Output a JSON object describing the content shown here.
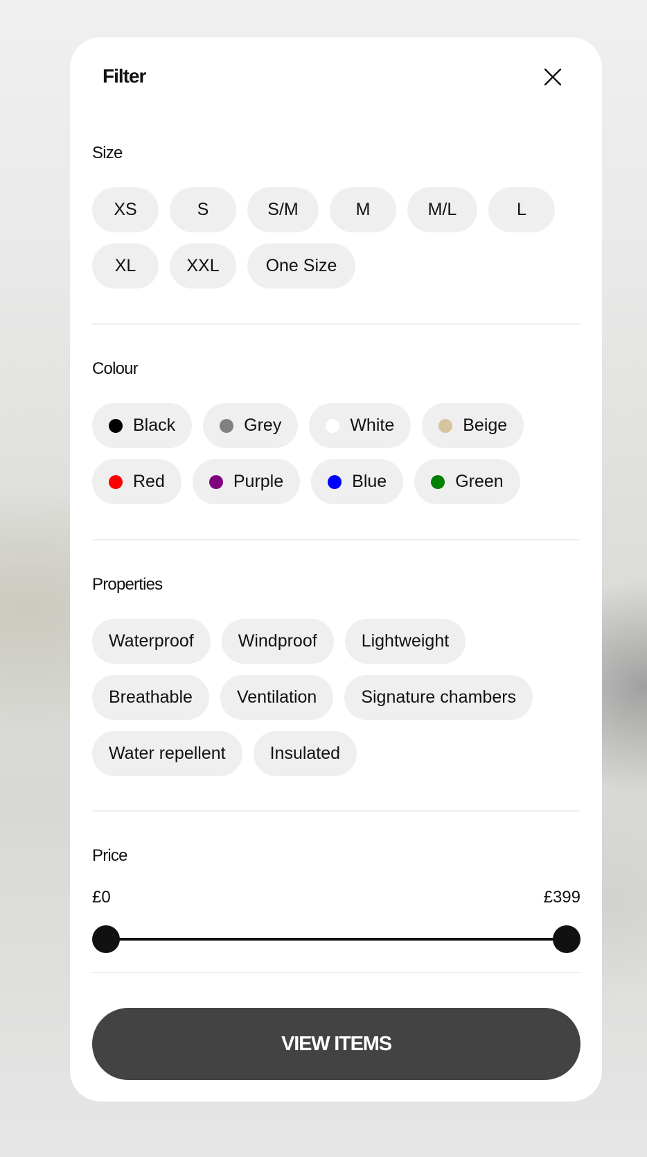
{
  "filter": {
    "title": "Filter",
    "close_icon": "close-icon"
  },
  "size": {
    "title": "Size",
    "options": [
      "XS",
      "S",
      "S/M",
      "M",
      "M/L",
      "L",
      "XL",
      "XXL",
      "One Size"
    ]
  },
  "colour": {
    "title": "Colour",
    "options": [
      {
        "label": "Black",
        "swatch": "#000000"
      },
      {
        "label": "Grey",
        "swatch": "#808080"
      },
      {
        "label": "White",
        "swatch": "#ffffff"
      },
      {
        "label": "Beige",
        "swatch": "#d6c49e"
      },
      {
        "label": "Red",
        "swatch": "#ff0000"
      },
      {
        "label": "Purple",
        "swatch": "#800080"
      },
      {
        "label": "Blue",
        "swatch": "#0000ff"
      },
      {
        "label": "Green",
        "swatch": "#008000"
      }
    ]
  },
  "properties": {
    "title": "Properties",
    "options": [
      "Waterproof",
      "Windproof",
      "Lightweight",
      "Breathable",
      "Ventilation",
      "Signature chambers",
      "Water repellent",
      "Insulated"
    ]
  },
  "price": {
    "title": "Price",
    "min_label": "£0",
    "max_label": "£399",
    "selected_min_fraction": 0,
    "selected_max_fraction": 1
  },
  "actions": {
    "view_items_label": "VIEW ITEMS",
    "button_color": "#434343"
  }
}
